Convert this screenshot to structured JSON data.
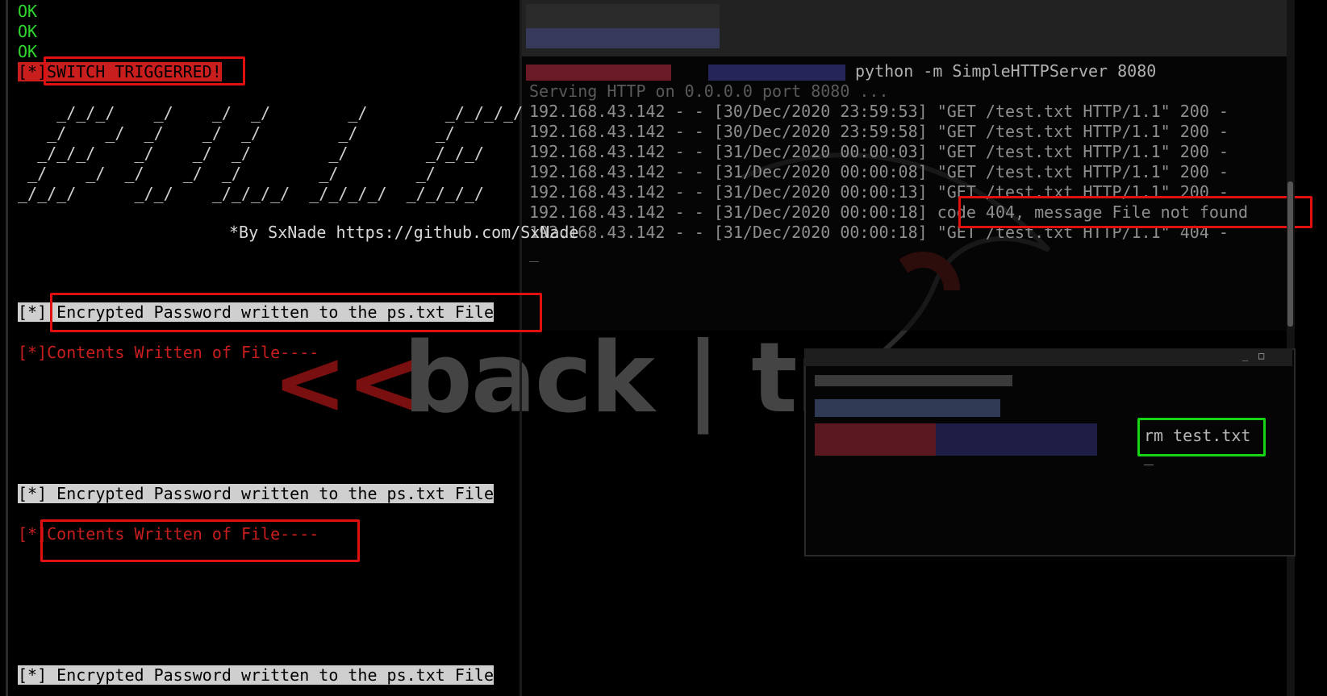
{
  "left_terminal": {
    "ok_lines": [
      "OK",
      "OK",
      "OK"
    ],
    "switch_prefix": "[*]",
    "switch_text": "SWITCH TRIGGERRED!",
    "ascii_art": [
      "    _/_/_/    _/    _/  _/        _/        _/_/_/_/",
      "   _/    _/  _/    _/  _/        _/        _/",
      "  _/_/_/    _/    _/  _/        _/        _/_/_/",
      " _/    _/  _/    _/  _/        _/        _/",
      "_/_/_/      _/_/    _/_/_/_/  _/_/_/_/  _/_/_/_/"
    ],
    "byline": "*By SxNade https://github.com/SxNade",
    "encrypted_line": "[*] Encrypted Password written to the ps.txt File",
    "contents_line": "[*]Contents Written of File----"
  },
  "wallpaper": {
    "arrows": "<< ",
    "brand": "back | tra"
  },
  "server_terminal": {
    "command": "python -m SimpleHTTPServer 8080",
    "serving": "Serving HTTP on 0.0.0.0 port 8080 ...",
    "log": [
      "192.168.43.142 - - [30/Dec/2020 23:59:53] \"GET /test.txt HTTP/1.1\" 200 -",
      "192.168.43.142 - - [30/Dec/2020 23:59:58] \"GET /test.txt HTTP/1.1\" 200 -",
      "192.168.43.142 - - [31/Dec/2020 00:00:03] \"GET /test.txt HTTP/1.1\" 200 -",
      "192.168.43.142 - - [31/Dec/2020 00:00:08] \"GET /test.txt HTTP/1.1\" 200 -",
      "192.168.43.142 - - [31/Dec/2020 00:00:13] \"GET /test.txt HTTP/1.1\" 200 -",
      "192.168.43.142 - - [31/Dec/2020 00:00:18] code 404, message File not found",
      "192.168.43.142 - - [31/Dec/2020 00:00:18] \"GET /test.txt HTTP/1.1\" 404 -"
    ],
    "cursor": "_"
  },
  "small_terminal": {
    "command": "rm test.txt",
    "cursor": "_",
    "controls": [
      "_",
      "□"
    ]
  },
  "colors": {
    "ok": "#2fd62f",
    "alert_red": "#c81e1e",
    "highlight_box_red": "#e01010",
    "highlight_box_green": "#14d414"
  }
}
